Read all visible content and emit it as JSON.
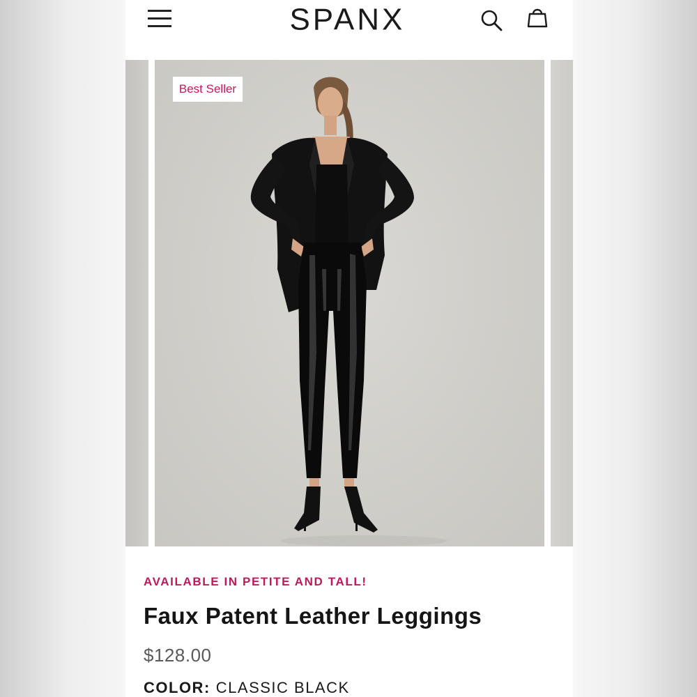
{
  "header": {
    "logo_text": "SPANX",
    "logo_mark": "®",
    "icons": [
      "hamburger-menu-icon",
      "search-icon",
      "shopping-bag-icon"
    ]
  },
  "carousel": {
    "badge": "Best Seller"
  },
  "product": {
    "availability": "AVAILABLE IN PETITE AND TALL!",
    "title": "Faux Patent Leather Leggings",
    "price": "$128.00",
    "color_label": "COLOR:",
    "color_value": "CLASSIC BLACK"
  },
  "colors": {
    "accent": "#c2185b",
    "text": "#151515",
    "price": "#5a5a5a"
  }
}
